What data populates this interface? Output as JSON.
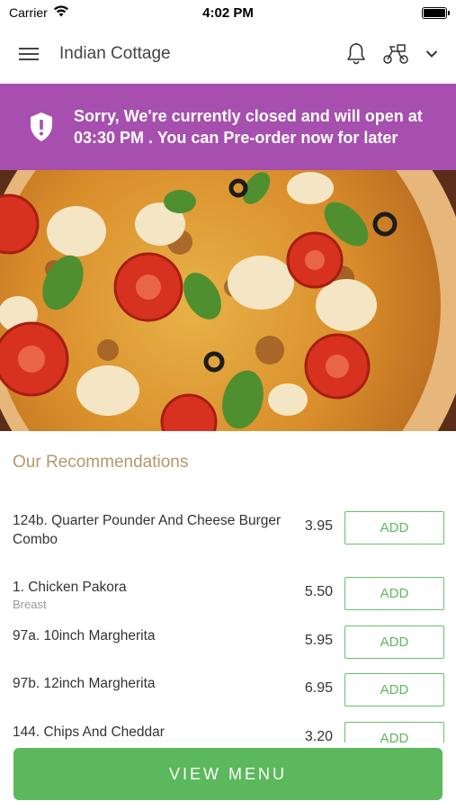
{
  "status_bar": {
    "carrier": "Carrier",
    "time": "4:02 PM"
  },
  "header": {
    "title": "Indian Cottage"
  },
  "banner": {
    "message": "Sorry, We're currently closed and will open at 03:30 PM . You can Pre-order now for later",
    "color": "#a64fae"
  },
  "recommendations": {
    "title": "Our Recommendations",
    "items": [
      {
        "name": "124b. Quarter Pounder And Cheese Burger Combo",
        "sub": "",
        "price": "3.95",
        "action": "ADD"
      },
      {
        "name": "1. Chicken Pakora",
        "sub": "Breast",
        "price": "5.50",
        "action": "ADD"
      },
      {
        "name": "97a. 10inch Margherita",
        "sub": "",
        "price": "5.95",
        "action": "ADD"
      },
      {
        "name": "97b. 12inch Margherita",
        "sub": "",
        "price": "6.95",
        "action": "ADD"
      },
      {
        "name": "144. Chips And Cheddar",
        "sub": "",
        "price": "3.20",
        "action": "ADD"
      }
    ]
  },
  "footer": {
    "view_menu_label": "VIEW MENU",
    "accent": "#5cb85c"
  }
}
